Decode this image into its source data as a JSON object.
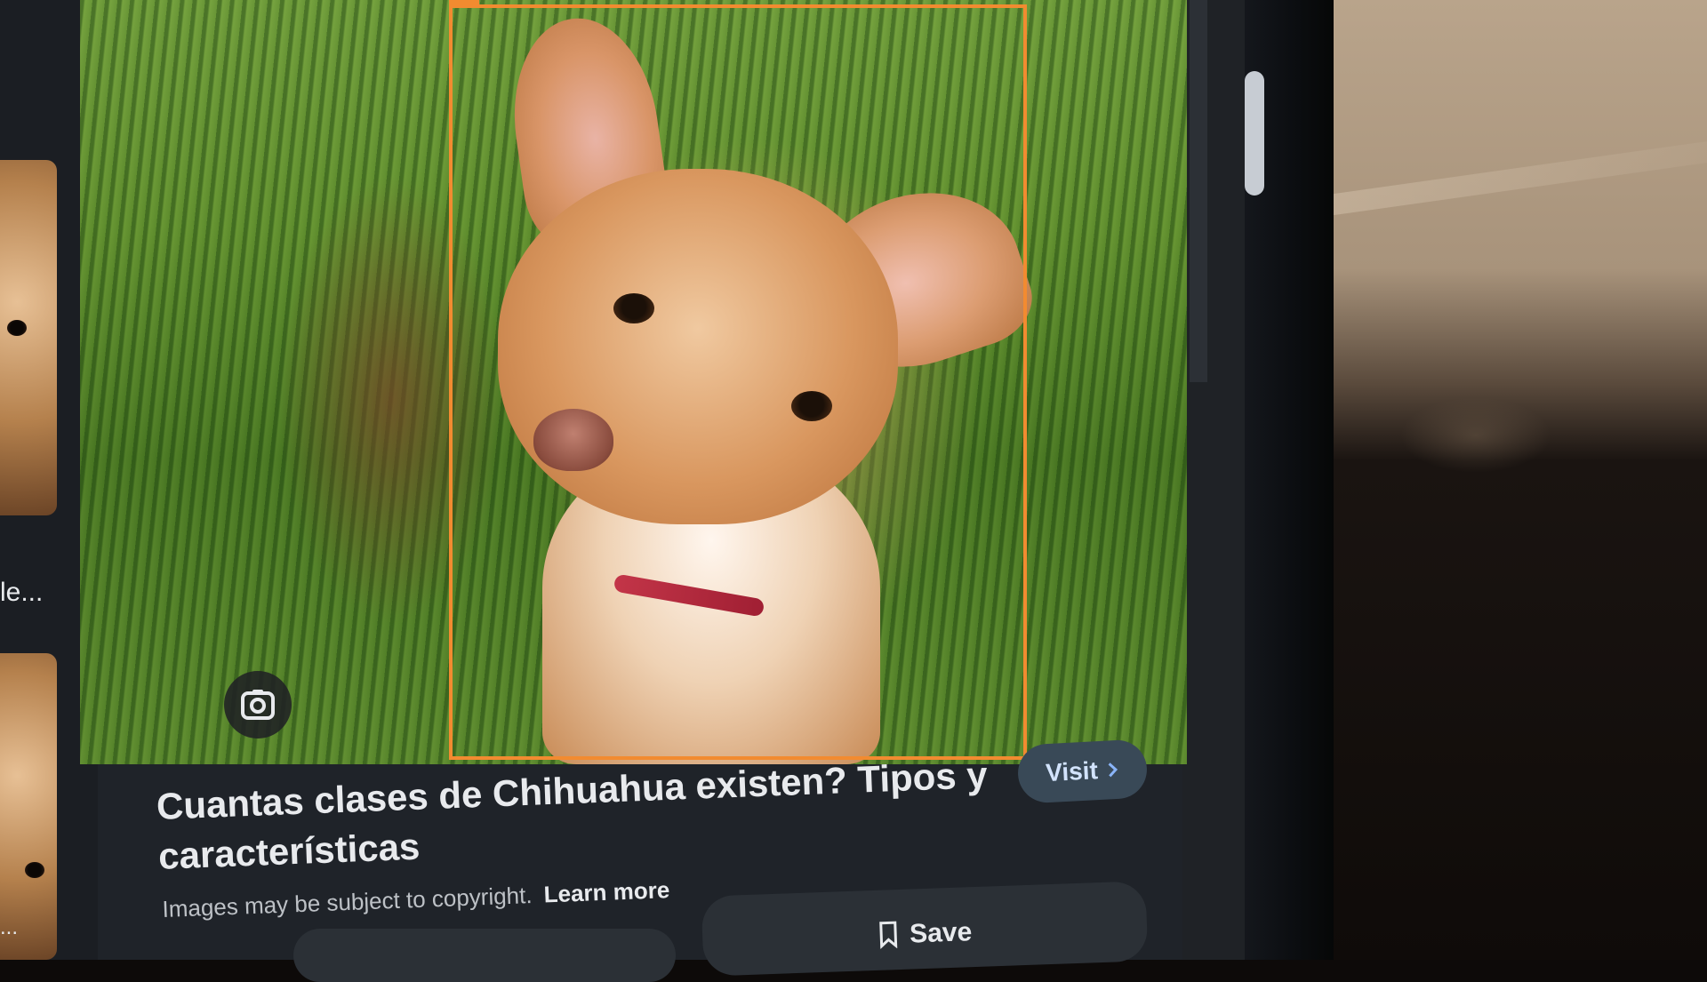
{
  "result": {
    "title": "Cuantas clases de Chihuahua existen? Tipos y características",
    "copyright_notice": "Images may be subject to copyright.",
    "learn_more_label": "Learn more",
    "visit_label": "Visit",
    "save_label": "Save"
  },
  "sidebar": {
    "thumb_caption": "le...",
    "thumb_caption_2": "..."
  },
  "icons": {
    "lens": "lens-icon",
    "visit": "chevron-right-icon",
    "save": "bookmark-icon"
  },
  "colors": {
    "selection": "#f28b30",
    "visit_bg": "#394957",
    "panel_bg": "#1f2329"
  }
}
